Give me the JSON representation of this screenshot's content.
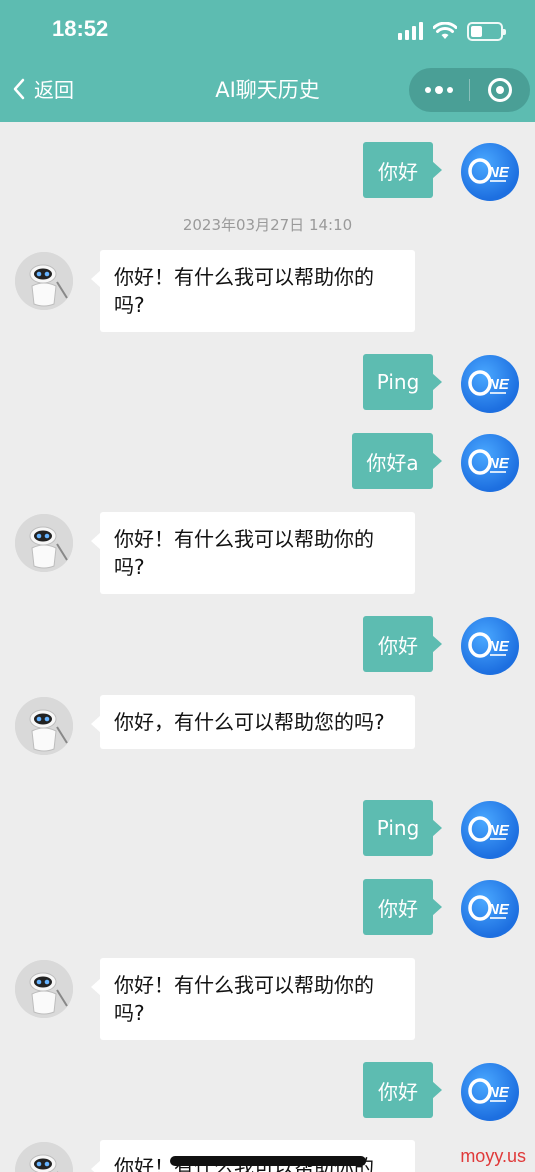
{
  "status_bar": {
    "time": "18:52",
    "battery_level": 0.4
  },
  "nav": {
    "back_label": "返回",
    "title": "AI聊天历史"
  },
  "timestamp": "2023年03月27日 14:10",
  "messages": [
    {
      "from": "user",
      "text": "你好"
    },
    {
      "from": "bot",
      "text": "你好！有什么我可以帮助你的吗?"
    },
    {
      "from": "user",
      "text": "Ping"
    },
    {
      "from": "user",
      "text": "你好a"
    },
    {
      "from": "bot",
      "text": "你好！有什么我可以帮助你的吗?"
    },
    {
      "from": "user",
      "text": "你好"
    },
    {
      "from": "bot",
      "text": "你好，有什么可以帮助您的吗?"
    },
    {
      "from": "user",
      "text": "Ping"
    },
    {
      "from": "user",
      "text": "你好"
    },
    {
      "from": "bot",
      "text": "你好！有什么我可以帮助你的吗?"
    },
    {
      "from": "user",
      "text": "你好"
    },
    {
      "from": "bot",
      "text": "你好！有什么我可以帮助你的"
    }
  ],
  "watermark": "moyy.us",
  "colors": {
    "accent": "#5dbcb1",
    "user_avatar": "#1d6fe0",
    "background": "#ededed"
  }
}
